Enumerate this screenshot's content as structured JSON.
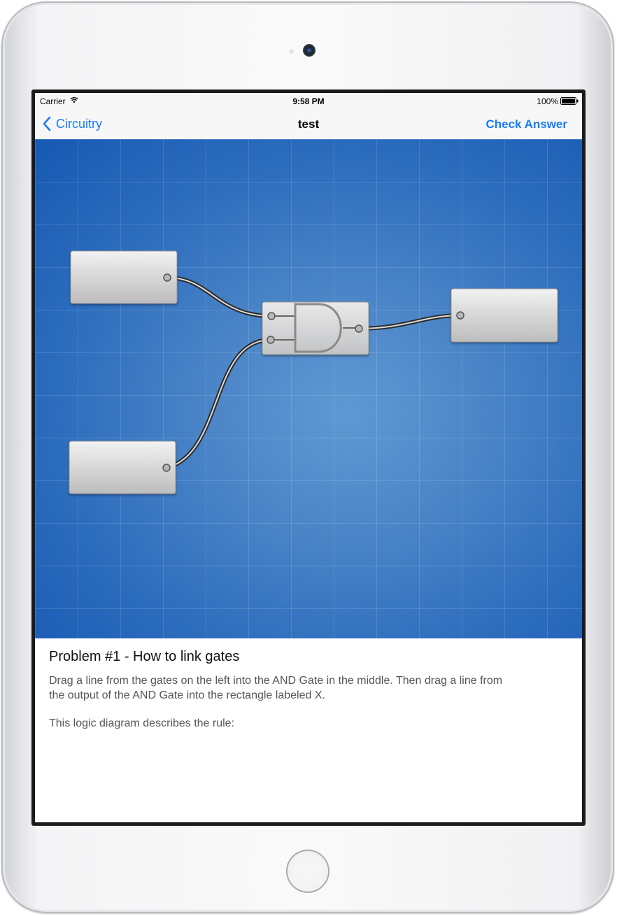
{
  "status_bar": {
    "carrier": "Carrier",
    "time": "9:58 PM",
    "battery": "100%"
  },
  "nav": {
    "back_label": "Circuitry",
    "title": "test",
    "action_label": "Check Answer"
  },
  "diagram": {
    "gate_type": "AND",
    "input_boxes": 2,
    "output_boxes": 1
  },
  "problem": {
    "title": "Problem #1 - How to link gates",
    "description": "Drag a line from the gates on the left into the AND Gate in the middle. Then drag a line from the output of the AND Gate into the rectangle labeled X.",
    "rule": "This logic diagram describes the rule:"
  },
  "colors": {
    "accent": "#1a7cf5",
    "canvas": "#2d6dbd"
  }
}
